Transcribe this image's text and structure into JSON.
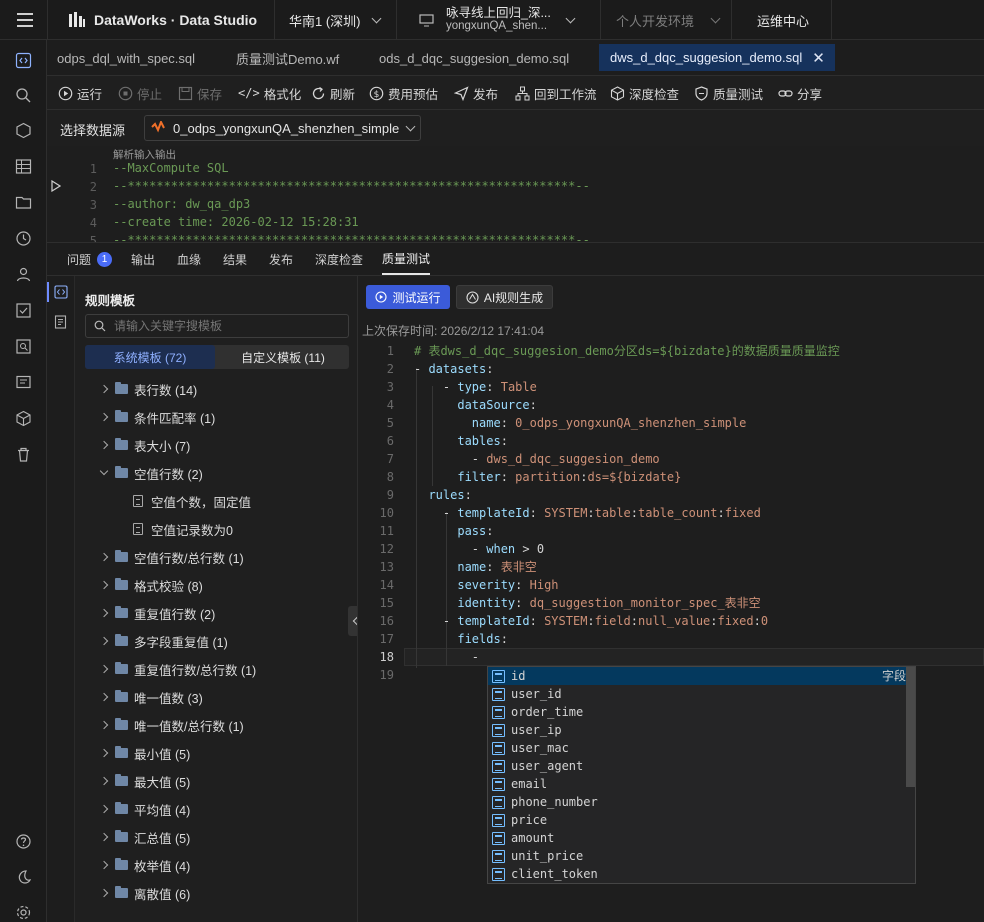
{
  "top": {
    "app": "DataWorks · Data Studio",
    "region": "华南1 (深圳)",
    "workspace_line1": "咏寻线上回归_深...",
    "workspace_line2": "yongxunQA_shen...",
    "env": "个人开发环境",
    "ops": "运维中心"
  },
  "tabs": [
    "odps_dql_with_spec.sql",
    "质量测试Demo.wf",
    "ods_d_dqc_suggesion_demo.sql",
    "dws_d_dqc_suggesion_demo.sql"
  ],
  "toolbar": {
    "run": "运行",
    "stop": "停止",
    "save": "保存",
    "format": "格式化",
    "refresh": "刷新",
    "cost": "费用预估",
    "publish": "发布",
    "back": "回到工作流",
    "deep": "深度检查",
    "quality": "质量测试",
    "share": "分享"
  },
  "datasource": {
    "label": "选择数据源",
    "value": "0_odps_yongxunQA_shenzhen_simple"
  },
  "editor": {
    "hint": "解析输入输出",
    "lines": [
      "--MaxCompute SQL",
      "--**************************************************************--",
      "--author: dw_qa_dp3",
      "--create time: 2026-02-12 15:28:31",
      "--**************************************************************--"
    ]
  },
  "bottom_tabs": {
    "issues": "问题",
    "issues_count": "1",
    "output": "输出",
    "lineage": "血缘",
    "result": "结果",
    "publish": "发布",
    "deep": "深度检查",
    "quality": "质量测试"
  },
  "rules_panel": {
    "title": "规则模板",
    "search_placeholder": "请输入关键字搜模板",
    "system_tab": "系统模板 (72)",
    "custom_tab": "自定义模板 (11)"
  },
  "tree": [
    {
      "label": "表行数 (14)",
      "type": "folder",
      "open": false
    },
    {
      "label": "条件匹配率 (1)",
      "type": "folder",
      "open": false
    },
    {
      "label": "表大小 (7)",
      "type": "folder",
      "open": false
    },
    {
      "label": "空值行数 (2)",
      "type": "folder",
      "open": true
    },
    {
      "label": "空值个数，固定值",
      "type": "leaf"
    },
    {
      "label": "空值记录数为0",
      "type": "leaf"
    },
    {
      "label": "空值行数/总行数 (1)",
      "type": "folder",
      "open": false
    },
    {
      "label": "格式校验 (8)",
      "type": "folder",
      "open": false
    },
    {
      "label": "重复值行数 (2)",
      "type": "folder",
      "open": false
    },
    {
      "label": "多字段重复值 (1)",
      "type": "folder",
      "open": false
    },
    {
      "label": "重复值行数/总行数 (1)",
      "type": "folder",
      "open": false
    },
    {
      "label": "唯一值数 (3)",
      "type": "folder",
      "open": false
    },
    {
      "label": "唯一值数/总行数 (1)",
      "type": "folder",
      "open": false
    },
    {
      "label": "最小值 (5)",
      "type": "folder",
      "open": false
    },
    {
      "label": "最大值 (5)",
      "type": "folder",
      "open": false
    },
    {
      "label": "平均值 (4)",
      "type": "folder",
      "open": false
    },
    {
      "label": "汇总值 (5)",
      "type": "folder",
      "open": false
    },
    {
      "label": "枚举值 (4)",
      "type": "folder",
      "open": false
    },
    {
      "label": "离散值 (6)",
      "type": "folder",
      "open": false
    }
  ],
  "quality": {
    "run_button": "测试运行",
    "ai_button": "AI规则生成",
    "last_saved": "上次保存时间: 2026/2/12 17:41:04"
  },
  "yaml": [
    [
      "g",
      "# 表dws_d_dqc_suggesion_demo分区ds=${bizdate}的数据质量质量监控"
    ],
    [
      "p",
      "- datasets:"
    ],
    [
      "p",
      "    - type: Table"
    ],
    [
      "p",
      "      dataSource:"
    ],
    [
      "p",
      "        name: 0_odps_yongxunQA_shenzhen_simple"
    ],
    [
      "p",
      "      tables:"
    ],
    [
      "p",
      "        - dws_d_dqc_suggesion_demo"
    ],
    [
      "p",
      "      filter: partition:ds=${bizdate}"
    ],
    [
      "p",
      "  rules:"
    ],
    [
      "p",
      "    - templateId: SYSTEM:table:table_count:fixed"
    ],
    [
      "p",
      "      pass:"
    ],
    [
      "p",
      "        - when > 0"
    ],
    [
      "p",
      "      name: 表非空"
    ],
    [
      "p",
      "      severity: High"
    ],
    [
      "p",
      "      identity: dq_suggestion_monitor_spec_表非空"
    ],
    [
      "p",
      "    - templateId: SYSTEM:field:null_value:fixed:0"
    ],
    [
      "p",
      "      fields:"
    ],
    [
      "p",
      "        -"
    ],
    [
      "p",
      ""
    ]
  ],
  "suggest": {
    "kind": "字段",
    "items": [
      "id",
      "user_id",
      "order_time",
      "user_ip",
      "user_mac",
      "user_agent",
      "email",
      "phone_number",
      "price",
      "amount",
      "unit_price",
      "client_token"
    ]
  }
}
